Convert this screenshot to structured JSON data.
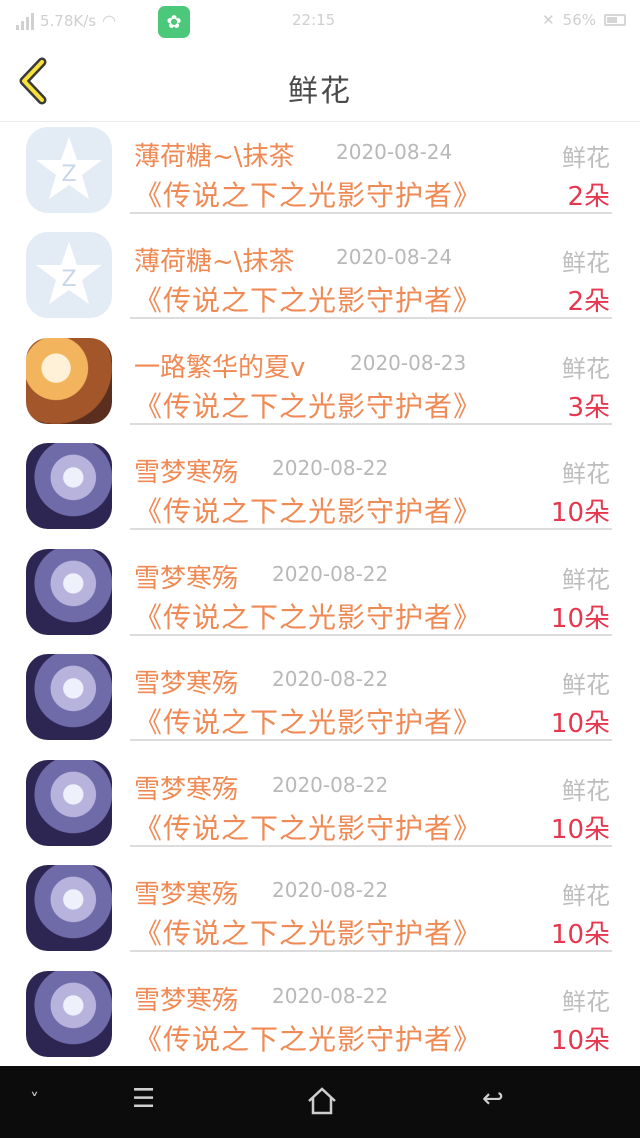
{
  "status_bar": {
    "speed": "5.78K/s",
    "time": "22:15",
    "battery": "56%"
  },
  "header": {
    "title": "鲜花"
  },
  "list": [
    {
      "name": "薄荷糖~\\抹茶",
      "date": "2020-08-24",
      "label": "鲜花",
      "book": "《传说之下之光影守护者》",
      "count": "2朵",
      "avatar": "qq"
    },
    {
      "name": "薄荷糖~\\抹茶",
      "date": "2020-08-24",
      "label": "鲜花",
      "book": "《传说之下之光影守护者》",
      "count": "2朵",
      "avatar": "qq"
    },
    {
      "name": "一路繁华的夏v",
      "date": "2020-08-23",
      "label": "鲜花",
      "book": "《传说之下之光影守护者》",
      "count": "3朵",
      "avatar": "orange"
    },
    {
      "name": "雪梦寒殇",
      "date": "2020-08-22",
      "label": "鲜花",
      "book": "《传说之下之光影守护者》",
      "count": "10朵",
      "avatar": "purple"
    },
    {
      "name": "雪梦寒殇",
      "date": "2020-08-22",
      "label": "鲜花",
      "book": "《传说之下之光影守护者》",
      "count": "10朵",
      "avatar": "purple"
    },
    {
      "name": "雪梦寒殇",
      "date": "2020-08-22",
      "label": "鲜花",
      "book": "《传说之下之光影守护者》",
      "count": "10朵",
      "avatar": "purple"
    },
    {
      "name": "雪梦寒殇",
      "date": "2020-08-22",
      "label": "鲜花",
      "book": "《传说之下之光影守护者》",
      "count": "10朵",
      "avatar": "purple"
    },
    {
      "name": "雪梦寒殇",
      "date": "2020-08-22",
      "label": "鲜花",
      "book": "《传说之下之光影守护者》",
      "count": "10朵",
      "avatar": "purple"
    },
    {
      "name": "雪梦寒殇",
      "date": "2020-08-22",
      "label": "鲜花",
      "book": "《传说之下之光影守护者》",
      "count": "10朵",
      "avatar": "purple"
    }
  ]
}
